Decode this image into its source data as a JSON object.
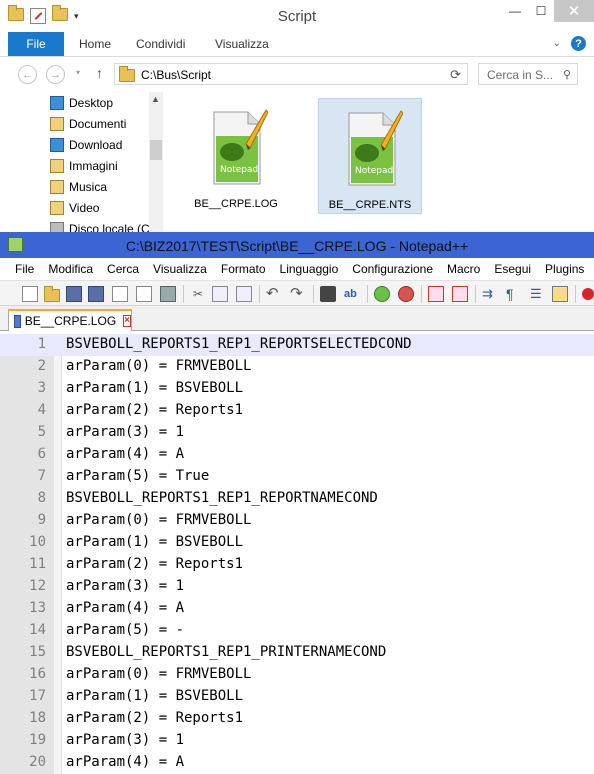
{
  "explorer": {
    "title": "Script",
    "ribbon": {
      "file_tab": "File",
      "tabs": [
        "Home",
        "Condividi",
        "Visualizza"
      ],
      "help": "?"
    },
    "address": "C:\\Bus\\Script",
    "search_placeholder": "Cerca in S...",
    "nav_items": [
      "Desktop",
      "Documenti",
      "Download",
      "Immagini",
      "Musica",
      "Video",
      "Disco locale (C"
    ],
    "files": [
      {
        "name": "BE__CRPE.LOG",
        "selected": false
      },
      {
        "name": "BE__CRPE.NTS",
        "selected": true
      }
    ],
    "window_buttons": [
      "minimize",
      "maximize",
      "close"
    ]
  },
  "npp": {
    "title": "C:\\BIZ2017\\TEST\\Script\\BE__CRPE.LOG - Notepad++",
    "menu": [
      "File",
      "Modifica",
      "Cerca",
      "Visualizza",
      "Formato",
      "Linguaggio",
      "Configurazione",
      "Macro",
      "Esegui",
      "Plugins"
    ],
    "tab": {
      "label": "BE__CRPE.LOG",
      "close": "×"
    },
    "lines": [
      "BSVEBOLL_REPORTS1_REP1_REPORTSELECTEDCOND",
      "arParam(0) = FRMVEBOLL",
      "arParam(1) = BSVEBOLL",
      "arParam(2) = Reports1",
      "arParam(3) = 1",
      "arParam(4) = A",
      "arParam(5) = True",
      "BSVEBOLL_REPORTS1_REP1_REPORTNAMECOND",
      "arParam(0) = FRMVEBOLL",
      "arParam(1) = BSVEBOLL",
      "arParam(2) = Reports1",
      "arParam(3) = 1",
      "arParam(4) = A",
      "arParam(5) = -",
      "BSVEBOLL_REPORTS1_REP1_PRINTERNAMECOND",
      "arParam(0) = FRMVEBOLL",
      "arParam(1) = BSVEBOLL",
      "arParam(2) = Reports1",
      "arParam(3) = 1",
      "arParam(4) = A"
    ],
    "current_line": 1
  }
}
